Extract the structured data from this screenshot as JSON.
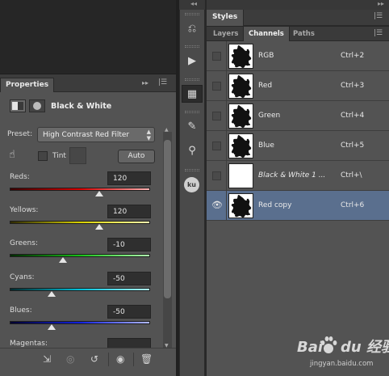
{
  "properties": {
    "tab_label": "Properties",
    "title": "Black & White",
    "preset_label": "Preset:",
    "preset_value": "High Contrast Red Filter",
    "tint_label": "Tint",
    "auto_label": "Auto",
    "sliders": [
      {
        "label": "Reds:",
        "value": "120",
        "level": 0.64,
        "gradient": [
          "#3a0000",
          "#d80000",
          "#ffb3b3"
        ]
      },
      {
        "label": "Yellows:",
        "value": "120",
        "level": 0.64,
        "gradient": [
          "#2e2a00",
          "#d8d000",
          "#ffffb0"
        ]
      },
      {
        "label": "Greens:",
        "value": "-10",
        "level": 0.38,
        "gradient": [
          "#002a00",
          "#18c018",
          "#b0ffb0"
        ]
      },
      {
        "label": "Cyans:",
        "value": "-50",
        "level": 0.3,
        "gradient": [
          "#002a2e",
          "#00c0d8",
          "#b0f8ff"
        ]
      },
      {
        "label": "Blues:",
        "value": "-50",
        "level": 0.3,
        "gradient": [
          "#00002e",
          "#1020e0",
          "#b0b8ff"
        ]
      },
      {
        "label": "Magentas:",
        "value": ""
      }
    ]
  },
  "styles": {
    "tab_label": "Styles"
  },
  "panel_tabs": [
    "Layers",
    "Channels",
    "Paths"
  ],
  "channels": [
    {
      "name": "RGB",
      "shortcut": "Ctrl+2",
      "visible": false,
      "thumb": "splat"
    },
    {
      "name": "Red",
      "shortcut": "Ctrl+3",
      "visible": false,
      "thumb": "splat"
    },
    {
      "name": "Green",
      "shortcut": "Ctrl+4",
      "visible": false,
      "thumb": "splat"
    },
    {
      "name": "Blue",
      "shortcut": "Ctrl+5",
      "visible": false,
      "thumb": "splat"
    },
    {
      "name": "Black & White 1 ...",
      "shortcut": "Ctrl+\\",
      "visible": false,
      "thumb": "blank"
    },
    {
      "name": "Red copy",
      "shortcut": "Ctrl+6",
      "visible": true,
      "thumb": "splat"
    }
  ],
  "watermark": {
    "logo": "Baidu 经验",
    "url": "jingyan.baidu.com"
  }
}
